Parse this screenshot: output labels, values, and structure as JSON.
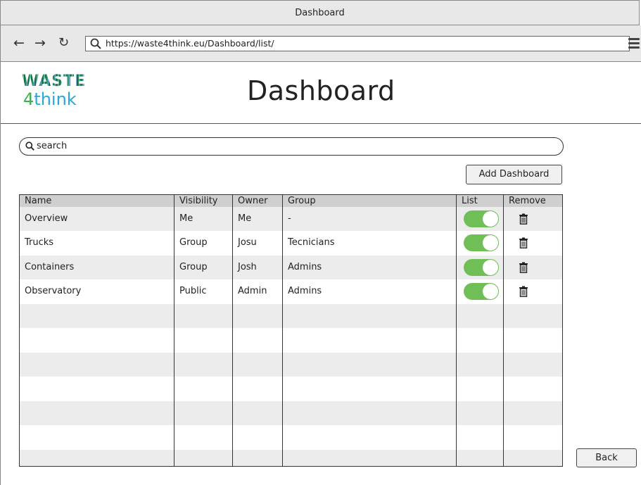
{
  "window": {
    "title": "Dashboard"
  },
  "browser": {
    "url": "https://waste4think.eu/Dashboard/list/",
    "icons": [
      "back-arrow-icon",
      "forward-arrow-icon",
      "reload-icon",
      "search-icon",
      "menu-icon"
    ]
  },
  "logo": {
    "line1": "WASTE",
    "line2_prefix": "4",
    "line2_rest": "think"
  },
  "header": {
    "title": "Dashboard"
  },
  "search": {
    "value": "search"
  },
  "actions": {
    "add_label": "Add Dashboard",
    "back_label": "Back"
  },
  "table": {
    "columns": [
      "Name",
      "Visibility",
      "Owner",
      "Group",
      "List",
      "Remove"
    ],
    "rows": [
      {
        "name": "Overview",
        "visibility": "Me",
        "owner": "Me",
        "group": "-",
        "list": true
      },
      {
        "name": "Trucks",
        "visibility": "Group",
        "owner": "Josu",
        "group": "Tecnicians",
        "list": true
      },
      {
        "name": "Containers",
        "visibility": "Group",
        "owner": "Josh",
        "group": "Admins",
        "list": true
      },
      {
        "name": "Observatory",
        "visibility": "Public",
        "owner": "Admin",
        "group": "Admins",
        "list": true
      }
    ]
  },
  "colors": {
    "toggle_on": "#6fbf56",
    "row_shade": "#ececec",
    "header_bg": "#cfcfcf"
  }
}
